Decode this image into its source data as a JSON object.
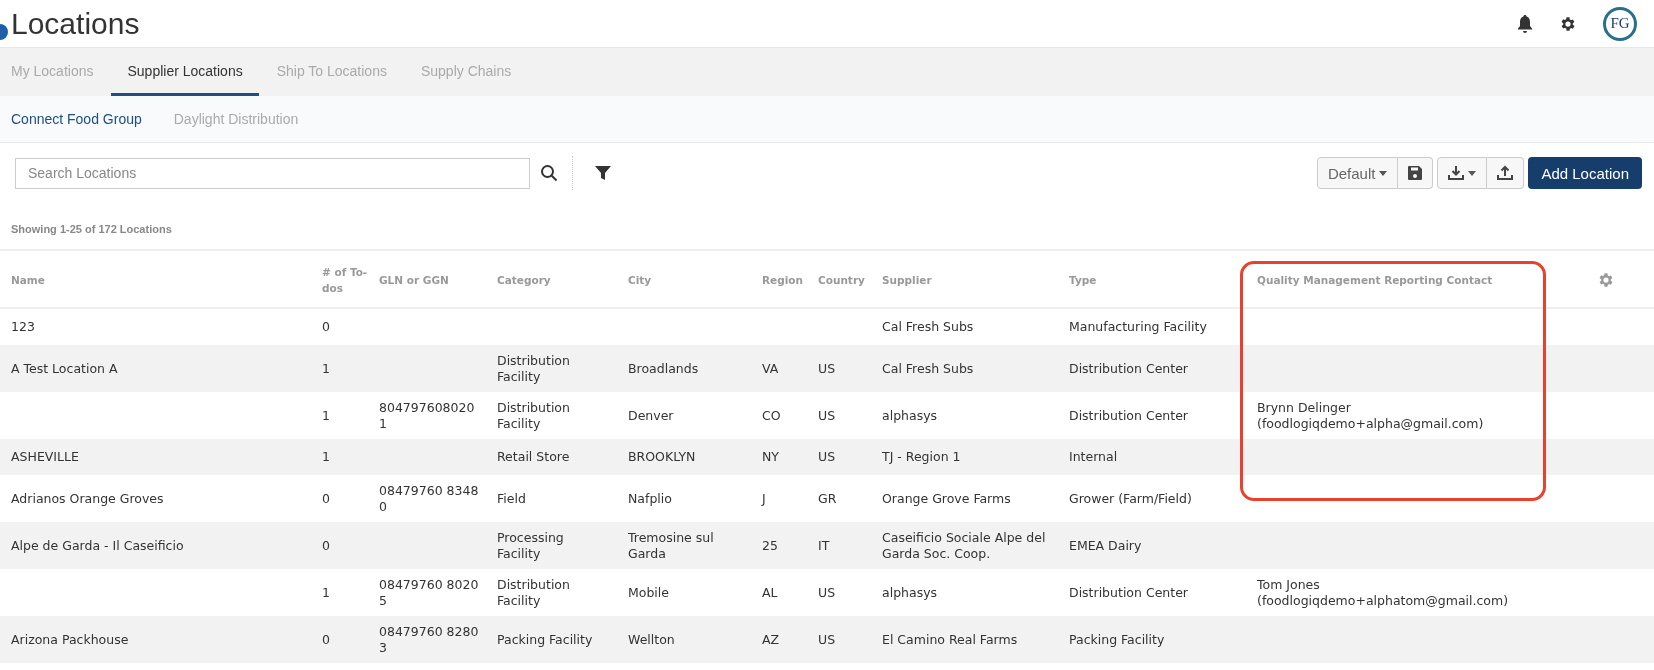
{
  "header": {
    "title": "Locations",
    "logo_text": "FG"
  },
  "tabs": [
    {
      "label": "My Locations",
      "selected": false
    },
    {
      "label": "Supplier Locations",
      "selected": true
    },
    {
      "label": "Ship To Locations",
      "selected": false
    },
    {
      "label": "Supply Chains",
      "selected": false
    }
  ],
  "subtabs": [
    {
      "label": "Connect Food Group",
      "selected": true
    },
    {
      "label": "Daylight Distribution",
      "selected": false
    }
  ],
  "search": {
    "placeholder": "Search Locations"
  },
  "toolbar": {
    "view": "Default",
    "add_button": "Add Location"
  },
  "summary": "Showing 1-25 of 172 Locations",
  "table": {
    "columns": [
      {
        "label": "Name",
        "highlighted": false
      },
      {
        "label": "# of To-dos",
        "highlighted": false
      },
      {
        "label": "GLN or GGN",
        "highlighted": false
      },
      {
        "label": "Category",
        "highlighted": false
      },
      {
        "label": "City",
        "highlighted": false
      },
      {
        "label": "Region",
        "highlighted": false
      },
      {
        "label": "Country",
        "highlighted": false
      },
      {
        "label": "Supplier",
        "highlighted": false
      },
      {
        "label": "Type",
        "highlighted": false
      },
      {
        "label": "Quality Management Reporting Contact",
        "highlighted": true
      }
    ],
    "rows": [
      {
        "cells": [
          "123",
          "0",
          null,
          null,
          null,
          null,
          null,
          "Cal Fresh Subs",
          "Manufacturing Facility",
          null
        ]
      },
      {
        "cells": [
          "A Test Location A",
          "1",
          null,
          "Distribution Facility",
          "Broadlands",
          "VA",
          "US",
          "Cal Fresh Subs",
          "Distribution Center",
          null
        ]
      },
      {
        "cells": [
          null,
          "1",
          "8047976080201",
          "Distribution Facility",
          "Denver",
          "CO",
          "US",
          "alphasys",
          "Distribution Center",
          "Brynn Delinger (foodlogiqdemo+alpha@gmail.com)"
        ]
      },
      {
        "cells": [
          "ASHEVILLE",
          "1",
          null,
          "Retail Store",
          "BROOKLYN",
          "NY",
          "US",
          "TJ - Region 1",
          "Internal",
          null
        ]
      },
      {
        "cells": [
          "Adrianos Orange Groves",
          "0",
          "08479760 83480",
          "Field",
          "Nafplio",
          "J",
          "GR",
          "Orange Grove Farms",
          "Grower (Farm/Field)",
          null
        ]
      },
      {
        "cells": [
          "Alpe de Garda - Il Caseificio",
          "0",
          null,
          "Processing Facility",
          "Tremosine sul Garda",
          "25",
          "IT",
          "Caseificio Sociale Alpe del Garda Soc. Coop.",
          "EMEA Dairy",
          null
        ]
      },
      {
        "cells": [
          null,
          "1",
          "08479760 80205",
          "Distribution Facility",
          "Mobile",
          "AL",
          "US",
          "alphasys",
          "Distribution Center",
          "Tom Jones (foodlogiqdemo+alphatom@gmail.com)"
        ]
      },
      {
        "cells": [
          "Arizona Packhouse",
          "0",
          "08479760 82803",
          "Packing Facility",
          "Wellton",
          "AZ",
          "US",
          "El Camino Real Farms",
          "Packing Facility",
          null
        ]
      }
    ]
  }
}
